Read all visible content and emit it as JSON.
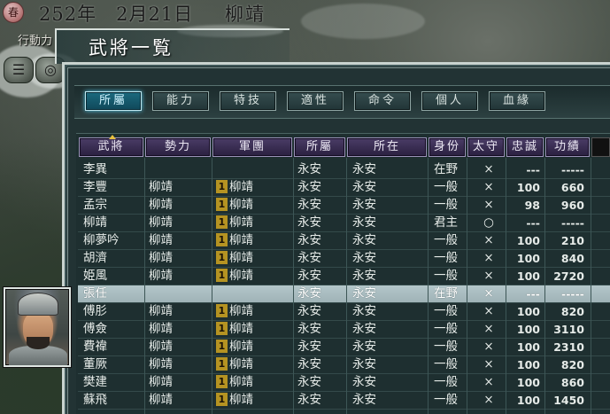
{
  "header": {
    "season_badge": "春",
    "date": "252年　2月21日",
    "ruler": "柳靖",
    "action_label": "行動力"
  },
  "panel": {
    "title": "武將一覧"
  },
  "tabs": [
    {
      "label": "所屬",
      "active": true
    },
    {
      "label": "能力",
      "active": false
    },
    {
      "label": "特技",
      "active": false
    },
    {
      "label": "適性",
      "active": false
    },
    {
      "label": "命令",
      "active": false
    },
    {
      "label": "個人",
      "active": false
    },
    {
      "label": "血緣",
      "active": false
    }
  ],
  "table": {
    "columns": [
      "武將",
      "勢力",
      "軍團",
      "所屬",
      "所在",
      "身份",
      "太守",
      "忠誠",
      "功績"
    ],
    "sorted_column": "武將",
    "rows": [
      {
        "name": "李異",
        "force": "",
        "corps_no": "",
        "corps": "",
        "city": "永安",
        "location": "永安",
        "status": "在野",
        "governor": "×",
        "loyalty": "---",
        "merit": "-----",
        "highlight": false
      },
      {
        "name": "李豐",
        "force": "柳靖",
        "corps_no": "1",
        "corps": "柳靖",
        "city": "永安",
        "location": "永安",
        "status": "一般",
        "governor": "×",
        "loyalty": "100",
        "merit": "660",
        "highlight": false
      },
      {
        "name": "孟宗",
        "force": "柳靖",
        "corps_no": "1",
        "corps": "柳靖",
        "city": "永安",
        "location": "永安",
        "status": "一般",
        "governor": "×",
        "loyalty": "98",
        "merit": "960",
        "highlight": false
      },
      {
        "name": "柳靖",
        "force": "柳靖",
        "corps_no": "1",
        "corps": "柳靖",
        "city": "永安",
        "location": "永安",
        "status": "君主",
        "governor": "○",
        "loyalty": "---",
        "merit": "-----",
        "highlight": false
      },
      {
        "name": "柳夢吟",
        "force": "柳靖",
        "corps_no": "1",
        "corps": "柳靖",
        "city": "永安",
        "location": "永安",
        "status": "一般",
        "governor": "×",
        "loyalty": "100",
        "merit": "210",
        "highlight": false
      },
      {
        "name": "胡濟",
        "force": "柳靖",
        "corps_no": "1",
        "corps": "柳靖",
        "city": "永安",
        "location": "永安",
        "status": "一般",
        "governor": "×",
        "loyalty": "100",
        "merit": "840",
        "highlight": false
      },
      {
        "name": "姫風",
        "force": "柳靖",
        "corps_no": "1",
        "corps": "柳靖",
        "city": "永安",
        "location": "永安",
        "status": "一般",
        "governor": "×",
        "loyalty": "100",
        "merit": "2720",
        "highlight": false
      },
      {
        "name": "張任",
        "force": "",
        "corps_no": "",
        "corps": "",
        "city": "永安",
        "location": "永安",
        "status": "在野",
        "governor": "×",
        "loyalty": "---",
        "merit": "-----",
        "highlight": true
      },
      {
        "name": "傅肜",
        "force": "柳靖",
        "corps_no": "1",
        "corps": "柳靖",
        "city": "永安",
        "location": "永安",
        "status": "一般",
        "governor": "×",
        "loyalty": "100",
        "merit": "820",
        "highlight": false
      },
      {
        "name": "傅僉",
        "force": "柳靖",
        "corps_no": "1",
        "corps": "柳靖",
        "city": "永安",
        "location": "永安",
        "status": "一般",
        "governor": "×",
        "loyalty": "100",
        "merit": "3110",
        "highlight": false
      },
      {
        "name": "費禕",
        "force": "柳靖",
        "corps_no": "1",
        "corps": "柳靖",
        "city": "永安",
        "location": "永安",
        "status": "一般",
        "governor": "×",
        "loyalty": "100",
        "merit": "2310",
        "highlight": false
      },
      {
        "name": "董厥",
        "force": "柳靖",
        "corps_no": "1",
        "corps": "柳靖",
        "city": "永安",
        "location": "永安",
        "status": "一般",
        "governor": "×",
        "loyalty": "100",
        "merit": "820",
        "highlight": false
      },
      {
        "name": "樊建",
        "force": "柳靖",
        "corps_no": "1",
        "corps": "柳靖",
        "city": "永安",
        "location": "永安",
        "status": "一般",
        "governor": "×",
        "loyalty": "100",
        "merit": "860",
        "highlight": false
      },
      {
        "name": "蘇飛",
        "force": "柳靖",
        "corps_no": "1",
        "corps": "柳靖",
        "city": "永安",
        "location": "永安",
        "status": "一般",
        "governor": "×",
        "loyalty": "100",
        "merit": "1450",
        "highlight": false
      }
    ]
  },
  "colors": {
    "panel_bg": "#223334",
    "header_purple": "#4a3c66",
    "highlight_row": "#b3c6c9",
    "corps_badge": "#b59322",
    "active_tab": "#1b6a7e"
  }
}
